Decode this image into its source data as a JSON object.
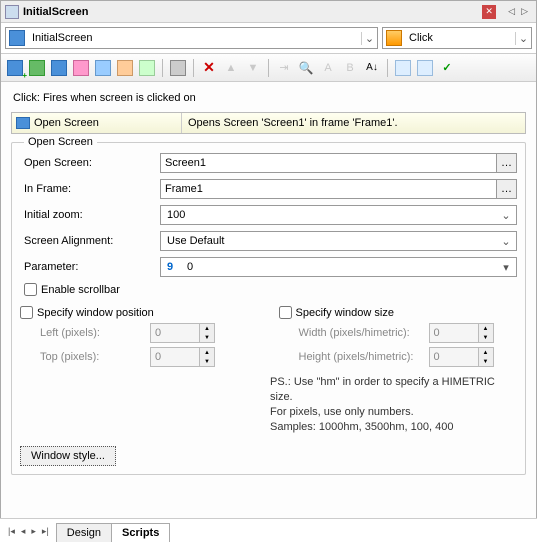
{
  "window": {
    "title": "InitialScreen"
  },
  "selectors": {
    "left": "InitialScreen",
    "right": "Click"
  },
  "description": "Click: Fires when screen is clicked on",
  "action": {
    "name": "Open Screen",
    "desc": "Opens Screen 'Screen1' in frame 'Frame1'."
  },
  "fieldset": {
    "legend": "Open Screen",
    "labels": {
      "openScreen": "Open Screen:",
      "inFrame": "In Frame:",
      "initialZoom": "Initial zoom:",
      "screenAlignment": "Screen Alignment:",
      "parameter": "Parameter:"
    },
    "values": {
      "openScreen": "Screen1",
      "inFrame": "Frame1",
      "initialZoom": "100",
      "screenAlignment": "Use Default",
      "parameterIcon": "9",
      "parameter": "0"
    },
    "checks": {
      "enableScrollbar": "Enable scrollbar",
      "specifyPos": "Specify window position",
      "specifySize": "Specify window size"
    },
    "pos": {
      "leftLabel": "Left (pixels):",
      "leftVal": "0",
      "topLabel": "Top (pixels):",
      "topVal": "0"
    },
    "size": {
      "widthLabel": "Width (pixels/himetric):",
      "widthVal": "0",
      "heightLabel": "Height (pixels/himetric):",
      "heightVal": "0"
    },
    "hint1": "PS.: Use \"hm\" in order to specify a HIMETRIC size.",
    "hint2": "For pixels, use only numbers.",
    "hint3": "Samples: 1000hm, 3500hm, 100, 400",
    "windowStyle": "Window style..."
  },
  "tabs": {
    "design": "Design",
    "scripts": "Scripts"
  }
}
